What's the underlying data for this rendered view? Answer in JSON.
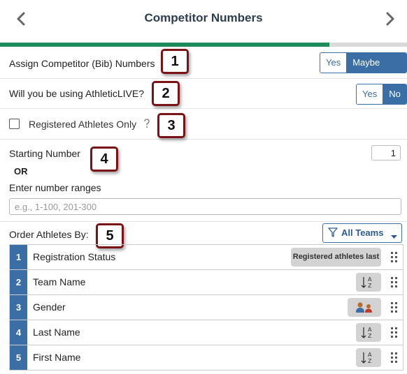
{
  "header": {
    "title": "Competitor Numbers",
    "prev_icon": "chevron-left-icon",
    "next_icon": "chevron-right-icon",
    "progress_fraction": 0.81,
    "progress_color": "#1e8c5a"
  },
  "rows": {
    "bib": {
      "label": "Assign Competitor (Bib) Numbers",
      "yes": "Yes",
      "maybe": "Maybe Later",
      "selected": "Maybe Later"
    },
    "live": {
      "label": "Will you be using AthleticLIVE?",
      "yes": "Yes",
      "no": "No",
      "selected": "No"
    },
    "registered": {
      "label": "Registered Athletes Only",
      "help_icon": "question-icon",
      "teams_label": "All Teams",
      "checked": false
    }
  },
  "numbering": {
    "starting_label": "Starting Number",
    "starting_value": "1",
    "or_label": "OR",
    "ranges_label": "Enter number ranges",
    "ranges_placeholder": "e.g., 1-100, 201-300"
  },
  "order": {
    "label": "Order Athletes By:",
    "items": [
      {
        "num": "1",
        "label": "Registration Status",
        "control": "Registered athletes last"
      },
      {
        "num": "2",
        "label": "Team Name",
        "control": "sort-az-icon"
      },
      {
        "num": "3",
        "label": "Gender",
        "control": "gender-icon"
      },
      {
        "num": "4",
        "label": "Last Name",
        "control": "sort-az-icon"
      },
      {
        "num": "5",
        "label": "First Name",
        "control": "sort-az-icon"
      }
    ]
  },
  "callouts": [
    "1",
    "2",
    "3",
    "4",
    "5"
  ],
  "colors": {
    "accent": "#3a6ea5",
    "callout_border": "#7a1414"
  }
}
